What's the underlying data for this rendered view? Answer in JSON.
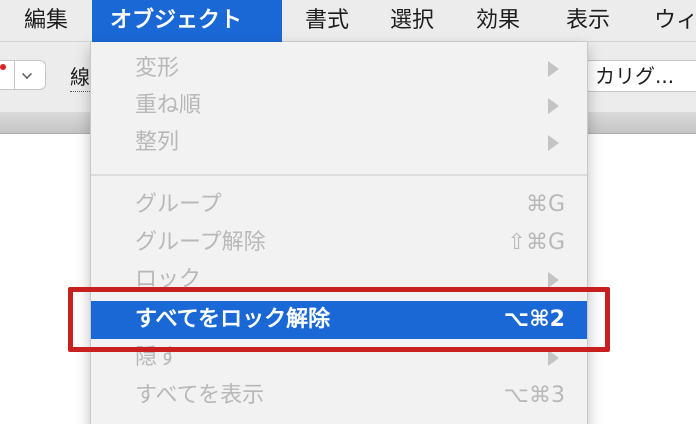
{
  "menubar": {
    "items": [
      {
        "label": "編集"
      },
      {
        "label": "オブジェクト"
      },
      {
        "label": "書式"
      },
      {
        "label": "選択"
      },
      {
        "label": "効果"
      },
      {
        "label": "表示"
      },
      {
        "label": "ウィ"
      }
    ]
  },
  "toolbar": {
    "stroke_label": "線",
    "font_value": "カリグ..."
  },
  "menu": {
    "items": [
      {
        "label": "変形",
        "shortcut": "",
        "submenu": true
      },
      {
        "label": "重ね順",
        "shortcut": "",
        "submenu": true
      },
      {
        "label": "整列",
        "shortcut": "",
        "submenu": true
      },
      {
        "label": "グループ",
        "shortcut": "⌘G",
        "submenu": false
      },
      {
        "label": "グループ解除",
        "shortcut": "⇧⌘G",
        "submenu": false
      },
      {
        "label": "ロック",
        "shortcut": "",
        "submenu": true
      },
      {
        "label": "すべてをロック解除",
        "shortcut": "⌥⌘2",
        "submenu": false
      },
      {
        "label": "隠す",
        "shortcut": "",
        "submenu": true
      },
      {
        "label": "すべてを表示",
        "shortcut": "⌥⌘3",
        "submenu": false
      }
    ]
  },
  "colors": {
    "highlight": "#1a68d6",
    "annotation": "#c8201e",
    "disabled_text": "#b8b8b8"
  }
}
